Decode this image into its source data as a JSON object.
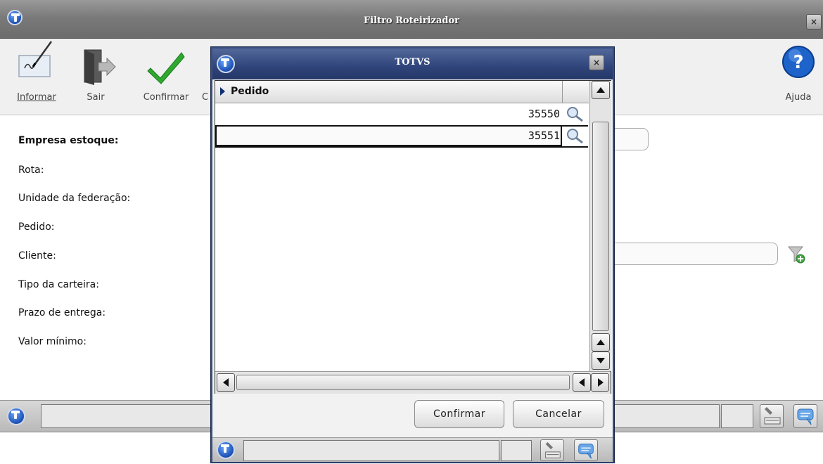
{
  "window": {
    "title": "Filtro Roteirizador",
    "close_label": "×"
  },
  "toolbar": {
    "informar": "Informar",
    "sair": "Sair",
    "confirmar": "Confirmar",
    "partial": "C",
    "ajuda": "Ajuda"
  },
  "form": {
    "labels": [
      "Empresa estoque:",
      "Rota:",
      "Unidade da federação:",
      "Pedido:",
      "Cliente:",
      "Tipo da carteira:",
      "Prazo de entrega:",
      "Valor mínimo:"
    ]
  },
  "dialog": {
    "title": "TOTVS",
    "close_label": "×",
    "grid": {
      "column_header": "Pedido",
      "rows": [
        "35550",
        "35551"
      ]
    },
    "confirm_label": "Confirmar",
    "cancel_label": "Cancelar"
  },
  "colors": {
    "main_titlebar": "#7a7a7a",
    "dialog_titlebar": "#2f447a",
    "accent_blue": "#1b4fb3",
    "check_green": "#2fa82f"
  },
  "icons": {
    "informar": "pen-signature-icon",
    "sair": "exit-door-icon",
    "confirmar": "checkmark-icon",
    "ajuda": "help-question-icon",
    "row_action": "magnifier-icon",
    "filter": "filter-funnel-icon",
    "status_tool": "keyboard-tool-icon",
    "status_chat": "chat-bubble-icon"
  }
}
